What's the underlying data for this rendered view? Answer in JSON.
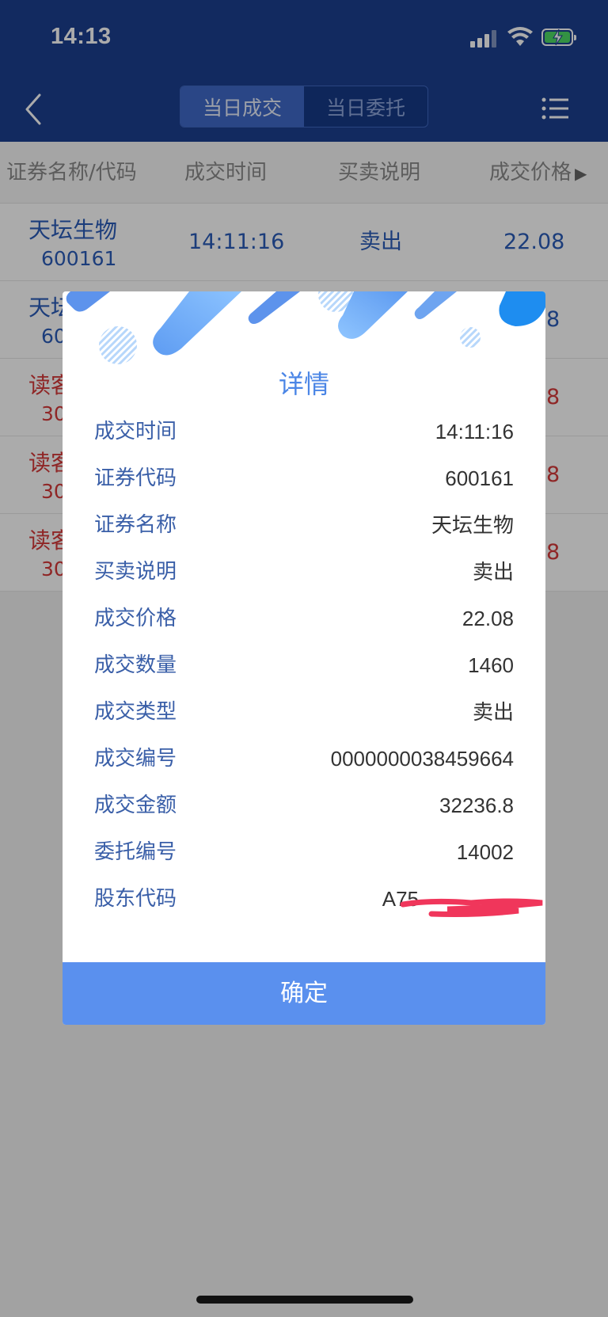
{
  "status_bar": {
    "time": "14:13"
  },
  "nav": {
    "tabs": [
      {
        "label": "当日成交",
        "active": true
      },
      {
        "label": "当日委托",
        "active": false
      }
    ]
  },
  "table": {
    "headers": [
      "证券名称/代码",
      "成交时间",
      "买卖说明",
      "成交价格"
    ],
    "rows": [
      {
        "name": "天坛生物",
        "code": "600161",
        "time": "14:11:16",
        "action": "卖出",
        "price": "22.08",
        "color": "blue"
      },
      {
        "name": "天坛",
        "code": "60",
        "time": "",
        "action": "",
        "price": "8",
        "color": "blue"
      },
      {
        "name": "读客",
        "code": "30",
        "time": "",
        "action": "",
        "price": "8",
        "color": "red"
      },
      {
        "name": "读客",
        "code": "30",
        "time": "",
        "action": "",
        "price": "8",
        "color": "red"
      },
      {
        "name": "读客",
        "code": "30",
        "time": "",
        "action": "",
        "price": "8",
        "color": "red"
      }
    ]
  },
  "dialog": {
    "title": "详情",
    "fields": [
      {
        "label": "成交时间",
        "value": "14:11:16"
      },
      {
        "label": "证券代码",
        "value": "600161"
      },
      {
        "label": "证券名称",
        "value": "天坛生物"
      },
      {
        "label": "买卖说明",
        "value": "卖出"
      },
      {
        "label": "成交价格",
        "value": "22.08"
      },
      {
        "label": "成交数量",
        "value": "1460"
      },
      {
        "label": "成交类型",
        "value": "卖出"
      },
      {
        "label": "成交编号",
        "value": "0000000038459664"
      },
      {
        "label": "成交金额",
        "value": "32236.8"
      },
      {
        "label": "委托编号",
        "value": "14002"
      },
      {
        "label": "股东代码",
        "value": "A75"
      }
    ],
    "confirm_label": "确定"
  },
  "colors": {
    "navbar": "#1c3f8f",
    "accent": "#5a90ee",
    "buy_sell_blue": "#2a5cb8",
    "buy_sell_red": "#d53a3a",
    "redaction": "#f0365b"
  }
}
